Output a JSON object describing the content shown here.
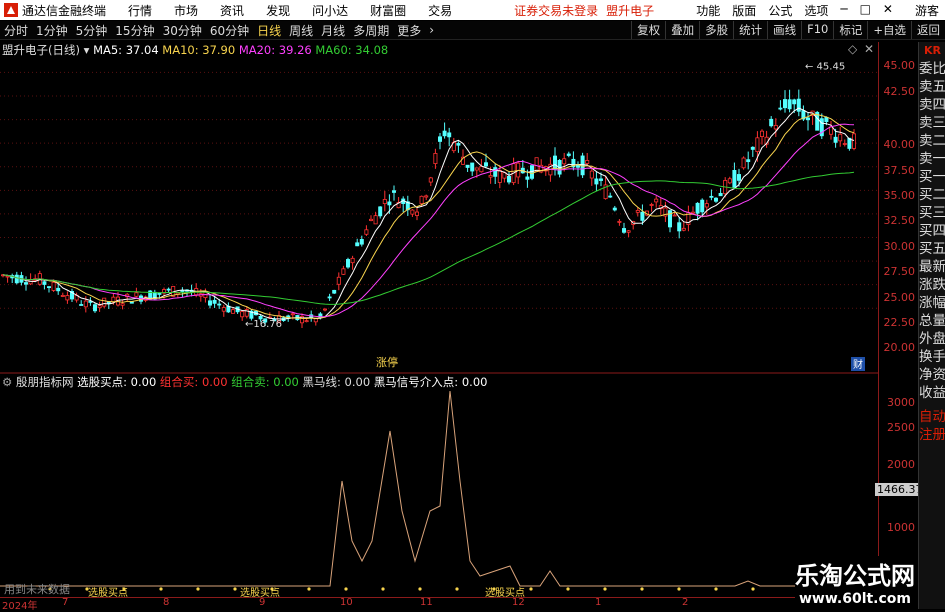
{
  "app": {
    "title": "通达信金融终端",
    "menu": [
      "行情",
      "市场",
      "资讯",
      "发现",
      "问小达",
      "财富圈",
      "交易"
    ],
    "status": "证券交易未登录",
    "stock_name": "盟升电子",
    "right_menu": [
      "功能",
      "版面",
      "公式",
      "选项"
    ],
    "guest": "游客"
  },
  "toolbar": {
    "periods": [
      "分时",
      "1分钟",
      "5分钟",
      "15分钟",
      "30分钟",
      "60分钟",
      "日线",
      "周线",
      "月线",
      "多周期",
      "更多"
    ],
    "active": "日线",
    "right": [
      "复权",
      "叠加",
      "多股",
      "统计",
      "画线",
      "F10",
      "标记",
      "+自选",
      "返回"
    ]
  },
  "main": {
    "title": "盟升电子(日线)",
    "ma5": "MA5: 37.04",
    "ma10": "MA10: 37.90",
    "ma20": "MA20: 39.26",
    "ma60": "MA60: 34.08",
    "price_labels": [
      "45.00",
      "42.50",
      "40.00",
      "37.50",
      "35.00",
      "32.50",
      "30.00",
      "27.50",
      "25.00",
      "22.50",
      "20.00"
    ],
    "high_label": "45.45",
    "low_label": "16.76",
    "zt_label": "涨停",
    "cai_label": "财"
  },
  "sub": {
    "title": "殷朋指标网",
    "buy": "选股买点: 0.00",
    "combo_buy": "组合买: 0.00",
    "combo_sell": "组合卖: 0.00",
    "black": "黑马线: 0.00",
    "black_sig": "黑马信号介入点: 0.00",
    "axis_labels": [
      "3000",
      "2500",
      "2000",
      "1500",
      "1000"
    ],
    "cursor_val": "1466.37",
    "nodata": "用到未来数据",
    "buy_tags": [
      "选股买点",
      "选股买点",
      "选股买点"
    ]
  },
  "dates": [
    "2024年",
    "7",
    "8",
    "9",
    "10",
    "11",
    "12",
    "1",
    "2"
  ],
  "right_panel": [
    "委比",
    "卖五",
    "卖四",
    "卖三",
    "卖二",
    "卖一",
    "买一",
    "买二",
    "买三",
    "买四",
    "买五",
    "最新",
    "涨跌",
    "涨幅",
    "总量",
    "外盘",
    "换手",
    "净资",
    "收益",
    "自动",
    "注册"
  ],
  "logo_tag": "KR",
  "watermark": {
    "line1": "乐淘公式网",
    "line2": "www.60lt.com"
  },
  "colors": {
    "up": "#ff3232",
    "down": "#54ffff",
    "ma5": "#ffffff",
    "ma10": "#f8d44e",
    "ma20": "#ff40ff",
    "ma60": "#33cc33"
  }
}
